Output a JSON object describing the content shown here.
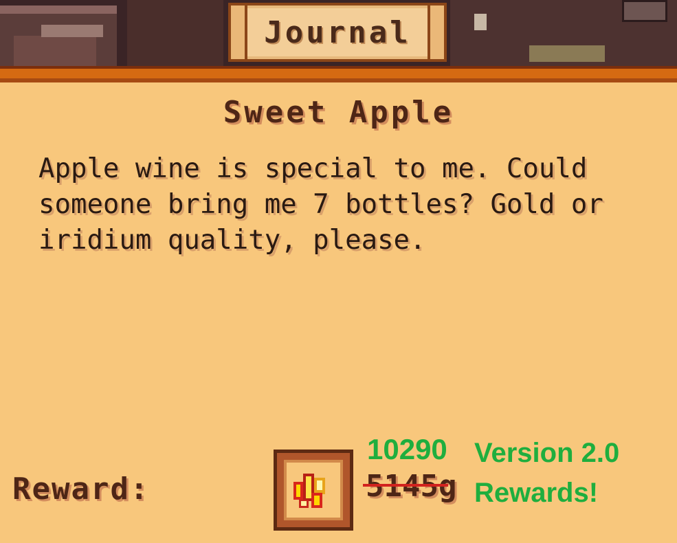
{
  "window": {
    "title": "Journal"
  },
  "quest": {
    "title": "Sweet Apple",
    "description": "Apple wine is special to me. Could someone bring me 7 bottles? Gold or iridium quality, please."
  },
  "reward": {
    "label": "Reward:",
    "old_amount": "5145g",
    "new_amount": "10290",
    "icon": "gold-coins-icon"
  },
  "annotation": {
    "line1": "Version 2.0",
    "line2": "Rewards!",
    "color": "#1fae3e"
  },
  "colors": {
    "panel": "#f8c77c",
    "text_dark": "#4e2616",
    "strike": "#d2221e"
  }
}
